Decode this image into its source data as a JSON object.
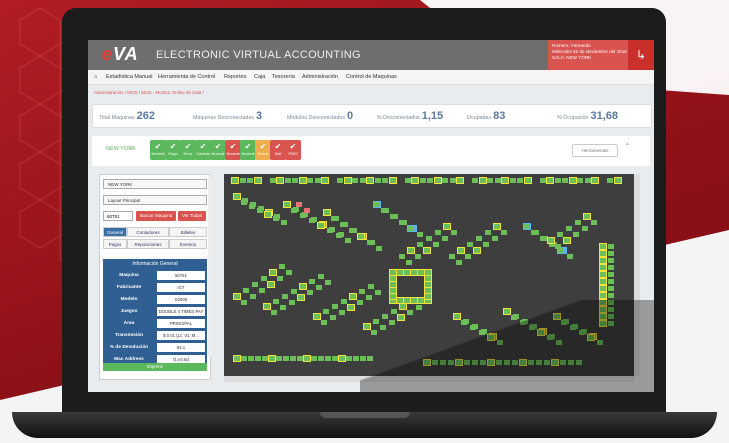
{
  "app": {
    "logo_text": "eva",
    "title": "ELECTRONIC VIRTUAL ACCOUNTING",
    "user_lines": [
      "Romero, Fernando",
      "Miércoles 02 de Noviembre del 2016",
      "SALA: NEW YORK"
    ],
    "logout_icon": "logout-icon"
  },
  "menu": [
    "Estadística Manual",
    "Herramienta de Control",
    "Reportes",
    "Caja",
    "Tesorería",
    "Administración",
    "Control de Maquinas"
  ],
  "breadcrumb": "Administración / MCD / MCD - Monitor Online de Sala /",
  "stats": [
    {
      "label": "Total Maquinas",
      "value": "262"
    },
    {
      "label": "Máquinas Desconectadas",
      "value": "3"
    },
    {
      "label": "Módulos Desconectados",
      "value": "0"
    },
    {
      "label": "% Desconectados",
      "value": "1,15"
    },
    {
      "label": "Ocupadas",
      "value": "83"
    },
    {
      "label": "% Ocupación",
      "value": "31,68"
    }
  ],
  "controls": {
    "city": "NEW YORK",
    "status_buttons": [
      {
        "label": "Normal",
        "color": "#5cb85c"
      },
      {
        "label": "Pago",
        "color": "#5cb85c"
      },
      {
        "label": "Error",
        "color": "#5cb85c"
      },
      {
        "label": "Cambio",
        "color": "#5cb85c"
      },
      {
        "label": "Normal",
        "color": "#5cb85c"
      },
      {
        "label": "Normal",
        "color": "#d9534f"
      },
      {
        "label": "Normal",
        "color": "#5cb85c"
      },
      {
        "label": "Fuera",
        "color": "#f0ad4e"
      },
      {
        "label": "Sell",
        "color": "#d9534f"
      },
      {
        "label": "PMO",
        "color": "#d9534f"
      }
    ],
    "tools": "Herramientas"
  },
  "panel": {
    "room_select": "NEW YORK",
    "layout_select": "Layout Principal",
    "machine_input": "50751",
    "search_button": "Buscar Maquina",
    "all_button": "Ver Todas",
    "tabs_row1": [
      "General",
      "Contadores",
      "Billetes"
    ],
    "tabs_row2": [
      "Pagos",
      "Reposiciones",
      "Eventos"
    ],
    "info_title": "Información General",
    "info": [
      {
        "key": "Maquina",
        "value": "50751"
      },
      {
        "key": "Fabricante",
        "value": "IGT"
      },
      {
        "key": "Modelo",
        "value": "S2000"
      },
      {
        "key": "Juegos",
        "value": "DOUBLE 4 TIMES PAY"
      },
      {
        "key": "Área",
        "value": "PRINCIPAL"
      },
      {
        "key": "Transmisión",
        "value": "$ 0.01 (1c. 01, M..."
      },
      {
        "key": "% de Devolución",
        "value": "94.1"
      },
      {
        "key": "Mac Address",
        "value": "f1:e4:6d"
      }
    ],
    "print_button": "Imprimir"
  }
}
